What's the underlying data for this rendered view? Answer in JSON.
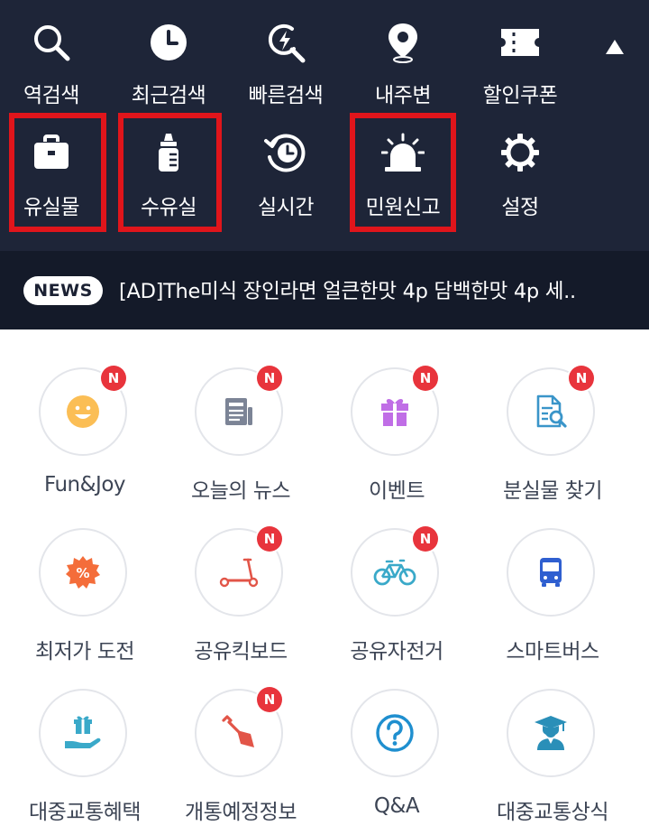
{
  "top_menu": {
    "row1": [
      {
        "label": "역검색",
        "icon": "search-icon"
      },
      {
        "label": "최근검색",
        "icon": "clock-icon"
      },
      {
        "label": "빠른검색",
        "icon": "quick-search-icon"
      },
      {
        "label": "내주변",
        "icon": "location-pin-icon"
      },
      {
        "label": "할인쿠폰",
        "icon": "coupon-icon"
      }
    ],
    "row2": [
      {
        "label": "유실물",
        "icon": "briefcase-icon",
        "highlighted": true
      },
      {
        "label": "수유실",
        "icon": "baby-bottle-icon",
        "highlighted": true
      },
      {
        "label": "실시간",
        "icon": "realtime-icon",
        "highlighted": false
      },
      {
        "label": "민원신고",
        "icon": "siren-icon",
        "highlighted": true
      },
      {
        "label": "설정",
        "icon": "gear-icon",
        "highlighted": false
      }
    ],
    "collapse_icon": "triangle-up-icon"
  },
  "news": {
    "badge": "NEWS",
    "text": "[AD]The미식 장인라면 얼큰한맛 4p   담백한맛 4p 세.."
  },
  "grid": [
    {
      "label": "Fun&Joy",
      "icon": "smiley-icon",
      "badge": "N"
    },
    {
      "label": "오늘의 뉴스",
      "icon": "newspaper-icon",
      "badge": "N"
    },
    {
      "label": "이벤트",
      "icon": "gift-icon",
      "badge": "N"
    },
    {
      "label": "분실물 찾기",
      "icon": "document-search-icon",
      "badge": "N"
    },
    {
      "label": "최저가 도전",
      "icon": "discount-tag-icon",
      "badge": ""
    },
    {
      "label": "공유킥보드",
      "icon": "kickboard-icon",
      "badge": "N"
    },
    {
      "label": "공유자전거",
      "icon": "bicycle-icon",
      "badge": "N"
    },
    {
      "label": "스마트버스",
      "icon": "bus-icon",
      "badge": ""
    },
    {
      "label": "대중교통혜택",
      "icon": "hand-gift-icon",
      "badge": ""
    },
    {
      "label": "개통예정정보",
      "icon": "shovel-icon",
      "badge": "N"
    },
    {
      "label": "Q&A",
      "icon": "question-icon",
      "badge": ""
    },
    {
      "label": "대중교통상식",
      "icon": "graduate-icon",
      "badge": ""
    }
  ],
  "colors": {
    "menu_bg": "#1e2538",
    "news_bg": "#141a29",
    "highlight": "#e0151b",
    "badge_red": "#e8343c"
  }
}
